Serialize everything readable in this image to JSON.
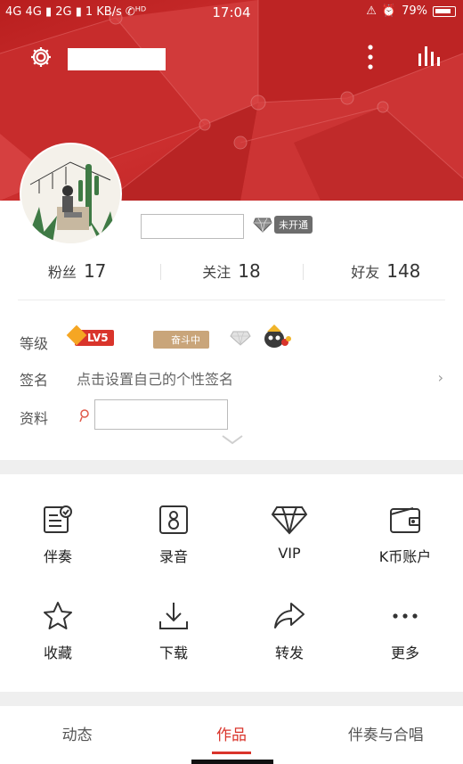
{
  "status_bar": {
    "signal": "4G 4G ▮ 2G ▮",
    "speed": "1 KB/s",
    "call_icon": "hd-call-icon",
    "time": "17:04",
    "battery": "79%"
  },
  "colors": {
    "accent": "#d9342b",
    "banner": "#c42828",
    "divider": "#efefef"
  },
  "vip_badge": {
    "text": "未开通"
  },
  "stats": [
    {
      "label": "粉丝",
      "value": "17"
    },
    {
      "label": "关注",
      "value": "18"
    },
    {
      "label": "好友",
      "value": "148"
    }
  ],
  "info": {
    "level_label": "等级",
    "level_badge": "LV5",
    "rank_badge": "奋斗中",
    "signature_label": "签名",
    "signature_text": "点击设置自己的个性签名",
    "profile_label": "资料"
  },
  "grid": [
    {
      "label": "伴奏",
      "icon": "accompaniment-icon"
    },
    {
      "label": "录音",
      "icon": "recording-icon"
    },
    {
      "label": "VIP",
      "icon": "vip-diamond-icon"
    },
    {
      "label": "K币账户",
      "icon": "wallet-icon"
    },
    {
      "label": "收藏",
      "icon": "star-icon"
    },
    {
      "label": "下载",
      "icon": "download-icon"
    },
    {
      "label": "转发",
      "icon": "share-icon"
    },
    {
      "label": "更多",
      "icon": "more-icon"
    }
  ],
  "tabs": [
    {
      "label": "动态",
      "active": false
    },
    {
      "label": "作品",
      "active": true
    },
    {
      "label": "伴奏与合唱",
      "active": false
    }
  ]
}
